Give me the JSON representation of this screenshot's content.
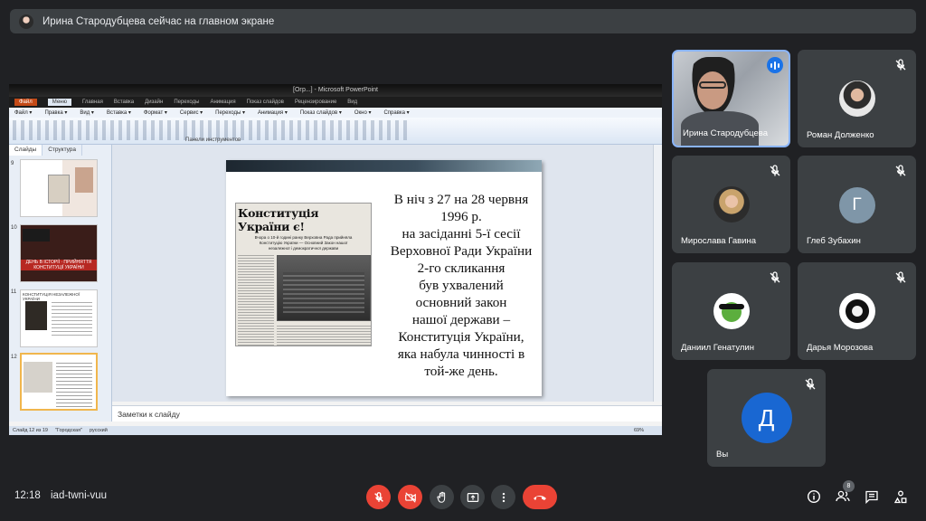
{
  "top_bar": {
    "presenter_text": "Ирина Стародубцева сейчас на главном экране"
  },
  "powerpoint": {
    "window_title": "[Огр...] - Microsoft PowerPoint",
    "ribbon_tabs": [
      "Файл",
      "Меню",
      "Главная",
      "Вставка",
      "Дизайн",
      "Переходы",
      "Анимация",
      "Показ слайдов",
      "Рецензирование",
      "Вид"
    ],
    "menu_items": [
      "Файл ▾",
      "Правка ▾",
      "Вид ▾",
      "Вставка ▾",
      "Формат ▾",
      "Сервис ▾",
      "Переходы ▾",
      "Анимация ▾",
      "Показ слайдов ▾",
      "Окно ▾",
      "Справка ▾"
    ],
    "ribbon_group_label": "Панели инструментов",
    "panel_tabs": [
      "Слайды",
      "Структура"
    ],
    "thumbnails": [
      {
        "num": "9",
        "style": "doc"
      },
      {
        "num": "10",
        "style": "red",
        "text": "ДЕНЬ В ІСТОРІЇ · ПРИЙНЯТТЯ КОНСТИТУЦІЇ УКРАЇНИ"
      },
      {
        "num": "11",
        "style": "doc",
        "text": "КОНСТИТУЦІЯ НЕЗАЛЕЖНОЇ УКРАЇНИ"
      },
      {
        "num": "12",
        "style": "current"
      }
    ],
    "slide": {
      "newspaper_headline": "Конституція України є!",
      "newspaper_subhead": "Вчора о 10-й годині ранку Верховна Рада прийняла Конституцію України — Основний Закон нашої незалежної і демократичної держави",
      "text": "В ніч з 27 на 28 червня\n1996 р.\nна засіданні 5-ї сесії\nВерховної Ради України\n2-го скликання\nбув ухвалений\nосновний закон\nнашої держави –\nКонституція України,\nяка набула чинності в\nтой-же день."
    },
    "notes_placeholder": "Заметки к слайду",
    "status": {
      "slide": "Слайд 12 из 19",
      "theme": "\"Городская\"",
      "lang": "русский",
      "zoom": "69%"
    }
  },
  "participants": [
    {
      "name": "Ирина Стародубцева",
      "type": "video",
      "speaking": true
    },
    {
      "name": "Роман Долженко",
      "type": "photo",
      "muted": true
    },
    {
      "name": "Мирослава Гавина",
      "type": "photo",
      "muted": true
    },
    {
      "name": "Глеб Зубахин",
      "type": "letter",
      "letter": "Г",
      "color": "#7f96a8",
      "muted": true
    },
    {
      "name": "Даниил Генатулин",
      "type": "photo",
      "muted": true
    },
    {
      "name": "Дарья Морозова",
      "type": "photo",
      "muted": true
    },
    {
      "name": "Вы",
      "type": "letter",
      "letter": "Д",
      "color": "#1967d2",
      "muted": true
    }
  ],
  "bottom_bar": {
    "time": "12:18",
    "meeting_code": "iad-twni-vuu",
    "participant_count": "8"
  },
  "colors": {
    "red": "#ea4335",
    "blue_border": "#8ab4f8",
    "tile": "#3c4043",
    "background": "#202124"
  }
}
